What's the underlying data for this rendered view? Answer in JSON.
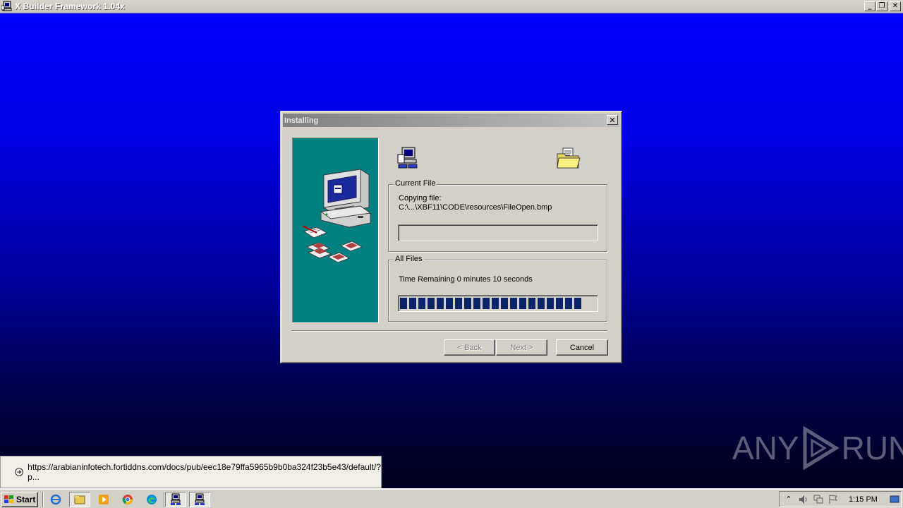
{
  "app": {
    "title": "X Builder Framework 1.04x",
    "controls": {
      "minimize": "_",
      "restore": "❐",
      "close": "✕"
    }
  },
  "dialog": {
    "title": "Installing",
    "close_glyph": "✕",
    "current_file": {
      "legend": "Current File",
      "label": "Copying file:",
      "path": "C:\\...\\XBF11\\CODE\\resources\\FileOpen.bmp",
      "progress_fraction": 0
    },
    "all_files": {
      "legend": "All Files",
      "time_remaining": "Time Remaining 0 minutes 10 seconds",
      "progress_fraction": 0.94
    },
    "buttons": {
      "back": "< Back",
      "next": "Next >",
      "cancel": "Cancel"
    }
  },
  "status_popup": {
    "url": "https://arabianinfotech.fortiddns.com/docs/pub/eec18e79ffa5965b9b0ba324f23b5e43/default/?p..."
  },
  "watermark": {
    "left": "ANY",
    "right": "RUN"
  },
  "taskbar": {
    "start_label": "Start",
    "quick_launch": [
      "ie-icon",
      "explorer-icon",
      "media-player-icon",
      "chrome-icon",
      "edge-icon",
      "installer-icon",
      "installer-icon"
    ],
    "clock": "1:15 PM"
  },
  "colors": {
    "desktop_top": "#0000ff",
    "desktop_bottom": "#00001c",
    "dialog_face": "#d4d0c8",
    "side_panel": "#008080",
    "progress_block": "#0a246a"
  }
}
